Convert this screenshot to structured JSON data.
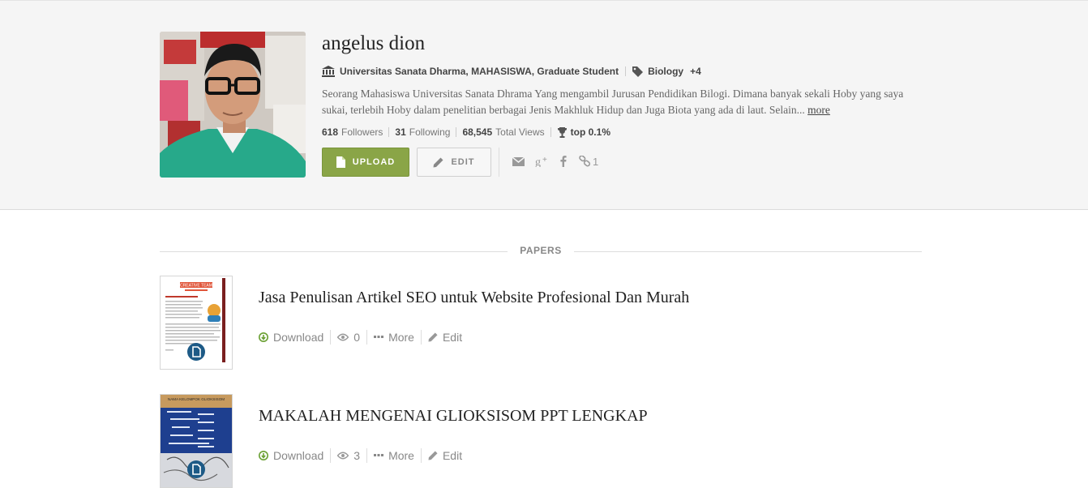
{
  "profile": {
    "name": "angelus dion",
    "affiliation": "Universitas Sanata Dharma, MAHASISWA, Graduate Student",
    "interest": "Biology",
    "interest_more": "+4",
    "bio": "Seorang Mahasiswa Universitas Sanata Dhrama Yang mengambil Jurusan Pendidikan Bilogi. Dimana banyak sekali Hoby yang saya sukai, terlebih Hoby dalam penelitian berbagai Jenis Makhluk Hidup dan Juga Biota yang ada di laut. Selain...",
    "bio_more": "more",
    "stats": {
      "followers_count": "618",
      "followers_label": "Followers",
      "following_count": "31",
      "following_label": "Following",
      "views_count": "68,545",
      "views_label": "Total Views",
      "rank": "top 0.1%"
    },
    "upload_label": "UPLOAD",
    "edit_label": "EDIT",
    "link_count": "1"
  },
  "papers": {
    "heading": "PAPERS",
    "items": [
      {
        "title": "Jasa Penulisan Artikel SEO untuk Website Profesional Dan Murah",
        "download": "Download",
        "views": "0",
        "more": "More",
        "edit": "Edit",
        "thumb_caption": "CREATIVE TEAM"
      },
      {
        "title": "MAKALAH MENGENAI GLIOKSISOM PPT LENGKAP",
        "download": "Download",
        "views": "3",
        "more": "More",
        "edit": "Edit",
        "thumb_caption": "NAMA KELOMPOK GLIOKSISOM"
      }
    ]
  },
  "colors": {
    "upload_button": "#8aa547",
    "download_icon": "#6aa033",
    "page_background": "#f5f5f5",
    "doc_badge": "#1d5a86"
  }
}
